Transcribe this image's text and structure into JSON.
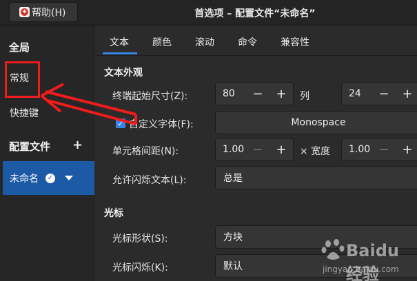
{
  "header": {
    "help_label": "帮助(H)",
    "title": "首选项 – 配置文件“未命名”"
  },
  "sidebar": {
    "global_heading": "全局",
    "general": "常规",
    "shortcuts": "快捷键",
    "profiles_heading": "配置文件",
    "add_symbol": "+",
    "profile_name": "未命名"
  },
  "tabs": [
    "文本",
    "颜色",
    "滚动",
    "命令",
    "兼容性"
  ],
  "text_appearance": {
    "heading": "文本外观",
    "size_label": "终端起始尺寸(Z):",
    "cols_value": "80",
    "cols_unit": "列",
    "rows_value": "24",
    "custom_font_label": "自定义字体(F):",
    "custom_font_checked": true,
    "font_value": "Monospace",
    "spacing_label": "单元格间距(N):",
    "spacing_value": "1.00",
    "width_label": "× 宽度",
    "width_value": "1.00",
    "blink_label": "允许闪烁文本(L):",
    "blink_value": "总是"
  },
  "cursor": {
    "heading": "光标",
    "shape_label": "光标形状(S):",
    "shape_value": "方块",
    "blink_label": "光标闪烁(K):",
    "blink_value": "默认"
  },
  "spin_symbols": {
    "minus": "−",
    "plus": "+"
  },
  "watermark": {
    "brand": "Baidu经验",
    "url": "jingyan.baidu.com"
  },
  "colors": {
    "accent": "#3584e4",
    "selection": "#1d5aa6",
    "annotation": "#ee1c1c"
  }
}
